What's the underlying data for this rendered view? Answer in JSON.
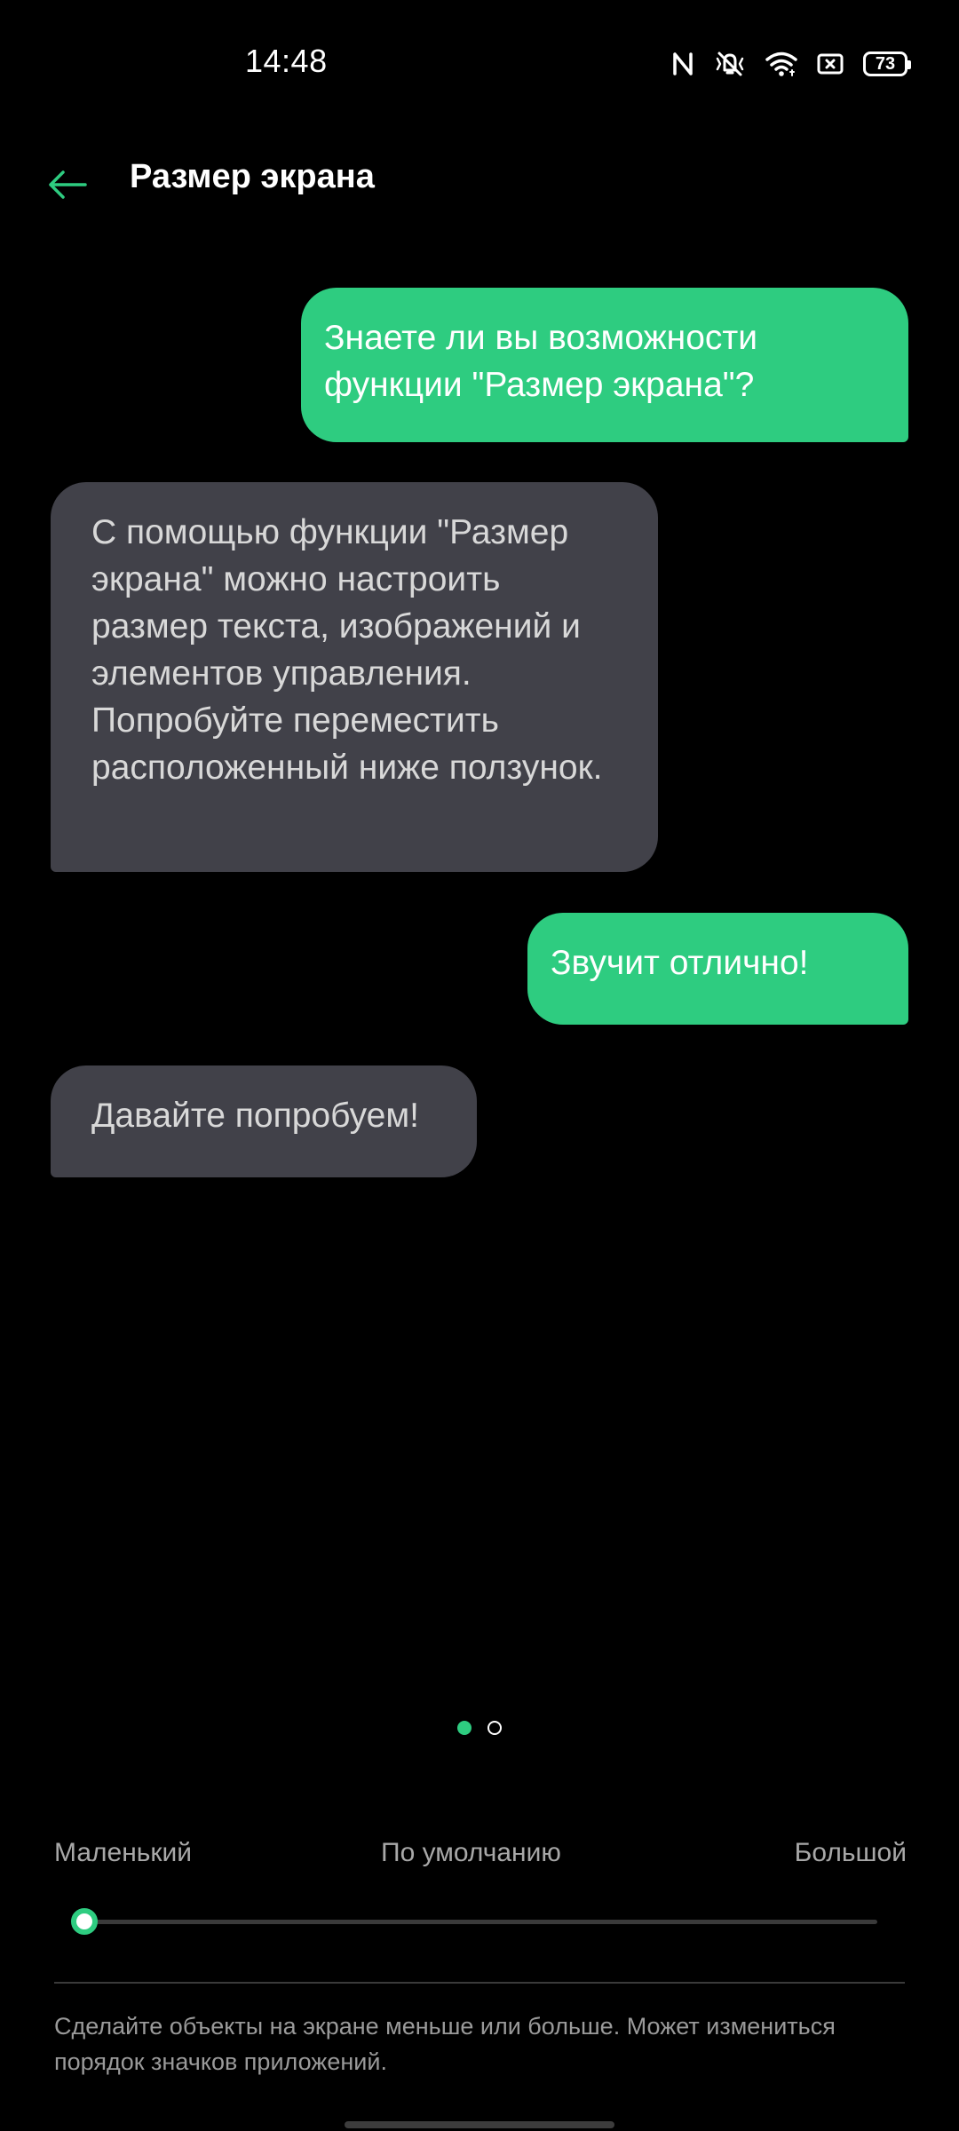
{
  "status_bar": {
    "time": "14:48",
    "icons": [
      "nfc-icon",
      "vibrate-off-icon",
      "wifi-icon",
      "screen-cast-icon",
      "battery-icon"
    ],
    "battery_level": "73"
  },
  "header": {
    "back_icon": "arrow-left-icon",
    "title": "Размер экрана"
  },
  "chat": {
    "messages": [
      {
        "from": "user",
        "text": "Знаете ли вы возможности функции \"Размер экрана\"?"
      },
      {
        "from": "bot",
        "text": "С помощью функции \"Размер экрана\" можно настроить размер текста, изображений и элементов управления. Попробуйте переместить расположенный ниже ползунок."
      },
      {
        "from": "user",
        "text": "Звучит отлично!"
      },
      {
        "from": "bot",
        "text": "Давайте попробуем!"
      }
    ]
  },
  "pagination": {
    "total": 2,
    "current": 1
  },
  "size_slider": {
    "labels": {
      "small": "Маленький",
      "default": "По умолчанию",
      "large": "Большой"
    },
    "value_fraction": 0.0
  },
  "description": "Сделайте объекты на экране меньше или больше. Может измениться порядок значков приложений.",
  "colors": {
    "accent": "#2ecc80",
    "background": "#000000",
    "bot_bubble": "#414149",
    "secondary_text": "#a8a8a8"
  }
}
